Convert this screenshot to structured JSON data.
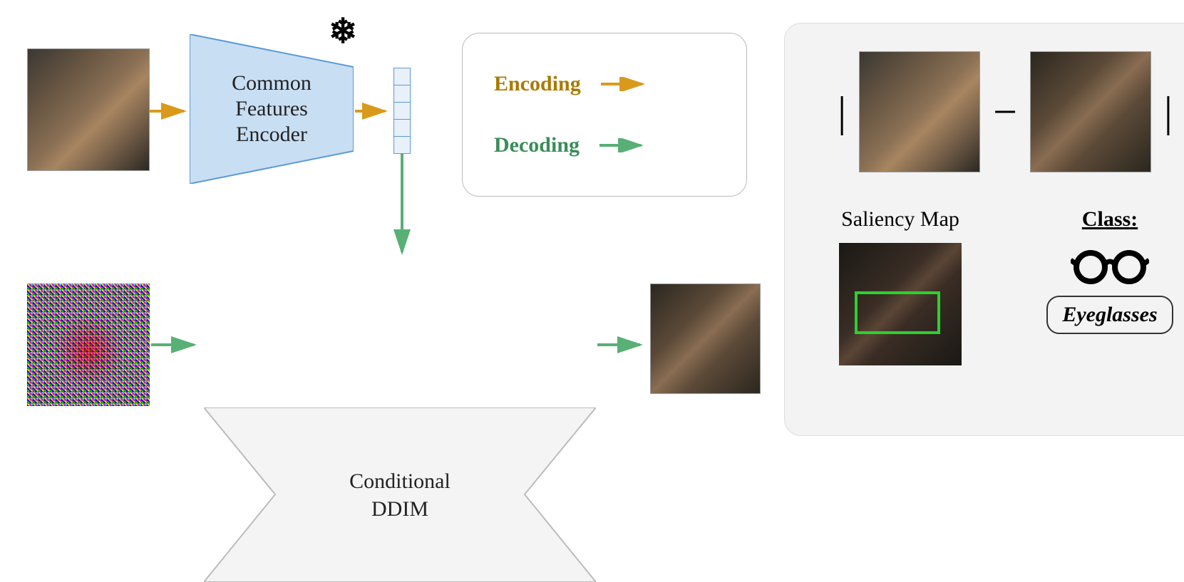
{
  "encoder": {
    "label_line1": "Common",
    "label_line2": "Features",
    "label_line3": "Encoder",
    "frozen_icon_name": "snowflake"
  },
  "decoder": {
    "label_line1": "Conditional",
    "label_line2": "DDIM"
  },
  "legend": {
    "encoding_label": "Encoding",
    "decoding_label": "Decoding",
    "encoding_color": "#d99a1c",
    "decoding_color": "#58b075"
  },
  "right_panel": {
    "abs_left": "|",
    "minus": "−",
    "abs_right": "|",
    "saliency_label": "Saliency Map",
    "class_heading": "Class:",
    "class_icon_name": "eyeglasses-icon",
    "class_value": "Eyeglasses"
  },
  "colors": {
    "arrow_enc": "#d99a1c",
    "arrow_dec": "#58b075",
    "encoder_fill": "#c8def3",
    "encoder_stroke": "#5a9bd5",
    "hourglass_fill": "#f4f4f4",
    "hourglass_stroke": "#bcbcbc",
    "saliency_box": "#2dd02d"
  }
}
